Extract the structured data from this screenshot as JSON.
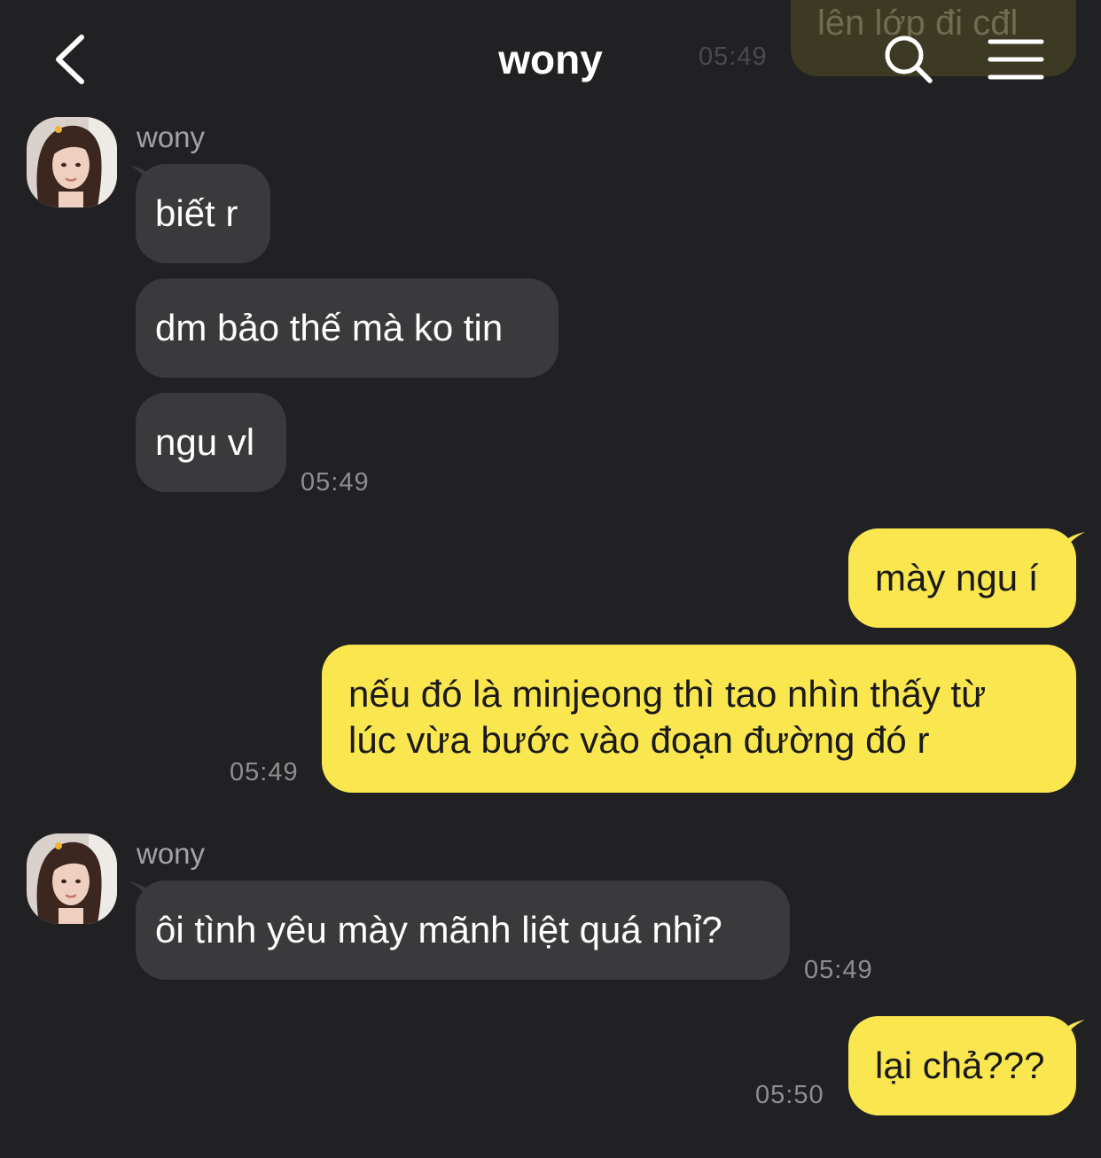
{
  "header": {
    "title": "wony",
    "back_icon": "chevron-left-icon",
    "search_icon": "search-icon",
    "menu_icon": "hamburger-menu-icon"
  },
  "colors": {
    "background": "#212123",
    "incoming_bubble": "#3a3a3c",
    "outgoing_bubble": "#fae64f",
    "timestamp": "#8e8e90"
  },
  "previous_message": {
    "text": "lên lớp đi cđl",
    "time": "05:49"
  },
  "groups": [
    {
      "sender": "wony",
      "messages": [
        "biết r",
        "dm bảo thế mà ko tin",
        "ngu vl"
      ],
      "time": "05:49"
    },
    {
      "sender": "me",
      "messages": [
        "mày ngu í",
        "nếu đó là minjeong thì tao nhìn thấy từ",
        "lúc vừa bước vào đoạn đường đó r"
      ],
      "time": "05:49"
    },
    {
      "sender": "wony",
      "messages": [
        "ôi tình yêu mày mãnh liệt quá nhỉ?"
      ],
      "time": "05:49"
    },
    {
      "sender": "me",
      "messages": [
        "lại chả???"
      ],
      "time": "05:50"
    }
  ]
}
